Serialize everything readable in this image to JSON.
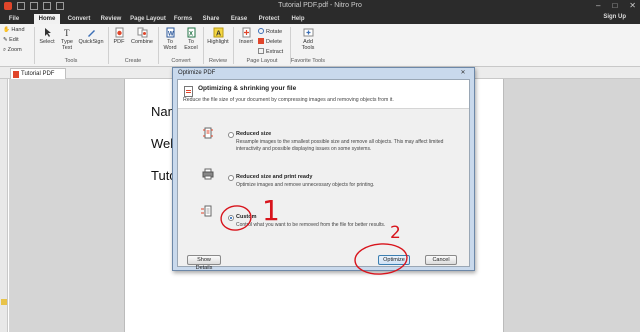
{
  "titlebar": {
    "title": "Tutorial PDF.pdf - Nitro Pro",
    "minimize": "–",
    "restore": "□",
    "close": "✕"
  },
  "menu_tabs": [
    "File",
    "Home",
    "Convert",
    "Review",
    "Page Layout",
    "Forms",
    "Share",
    "Erase",
    "Protect",
    "Help"
  ],
  "active_tab": "Home",
  "sign_up": "Sign Up",
  "left_tools": {
    "hand": "Hand",
    "edit": "Edit",
    "zoom": "Zoom"
  },
  "ribbon": {
    "select": "Select",
    "type_text": "Type Text",
    "quicksign": "QuickSign",
    "tools_group": "Tools",
    "pdf": "PDF",
    "combine": "Combine",
    "create_group": "Create",
    "to_word": "To Word",
    "to_excel": "To Excel",
    "convert_group": "Convert",
    "highlight": "Highlight",
    "review_group": "Review",
    "insert": "Insert",
    "rotate": "Rotate",
    "delete": "Delete",
    "extract": "Extract",
    "page_layout_group": "Page Layout",
    "add_tools": "Add Tools",
    "favorite_group": "Favorite Tools"
  },
  "doc_tab": "Tutorial PDF",
  "document_lines": [
    "Nam",
    "Wel",
    "Tuto"
  ],
  "dialog": {
    "title": "Optimize PDF",
    "close": "✕",
    "heading": "Optimizing & shrinking your file",
    "subheading": "Reduce the file size of your document by compressing images and removing objects from it.",
    "options": [
      {
        "title": "Reduced size",
        "desc": "Resample images to the smallest possible size and remove all objects. This may affect limited interactivity and possible displaying issues on some systems.",
        "selected": false,
        "icon": "compress-icon"
      },
      {
        "title": "Reduced size and print ready",
        "desc": "Optimize images and remove unnecessary objects for printing.",
        "selected": false,
        "icon": "printer-icon"
      },
      {
        "title": "Custom",
        "desc": "Control what you want to be removed from the file for better results.",
        "selected": true,
        "icon": "custom-settings-icon"
      }
    ],
    "show_details": "Show Details",
    "optimize": "Optimize",
    "cancel": "Cancel"
  },
  "annotations": {
    "one": "1",
    "two": "2"
  },
  "colors": {
    "accent_red": "#e0452a",
    "annotation_red": "#d8141c",
    "dialog_frame": "#c9d9ec"
  }
}
